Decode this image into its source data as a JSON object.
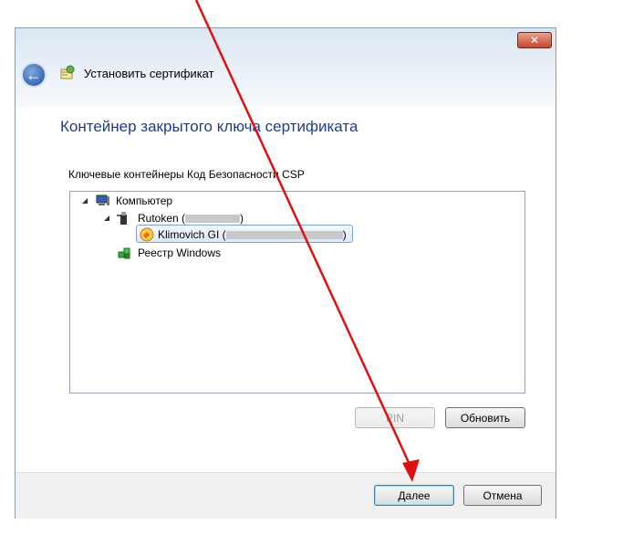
{
  "window": {
    "close_label": "✕",
    "title": "Установить сертификат"
  },
  "content": {
    "heading": "Контейнер закрытого ключа сертификата",
    "tree_label": "Ключевые контейнеры Код Безопасности CSP",
    "tree": {
      "computer": "Компьютер",
      "rutoken": "Rutoken (",
      "rutoken_suffix": ")",
      "key": "Klimovich GI (",
      "key_suffix": ")",
      "registry": "Реестр Windows"
    },
    "pin_button": "PIN",
    "refresh_button": "Обновить"
  },
  "footer": {
    "next_button": "Далее",
    "cancel_button": "Отмена"
  },
  "colors": {
    "heading": "#1c3d8c",
    "arrow": "#e01010"
  }
}
